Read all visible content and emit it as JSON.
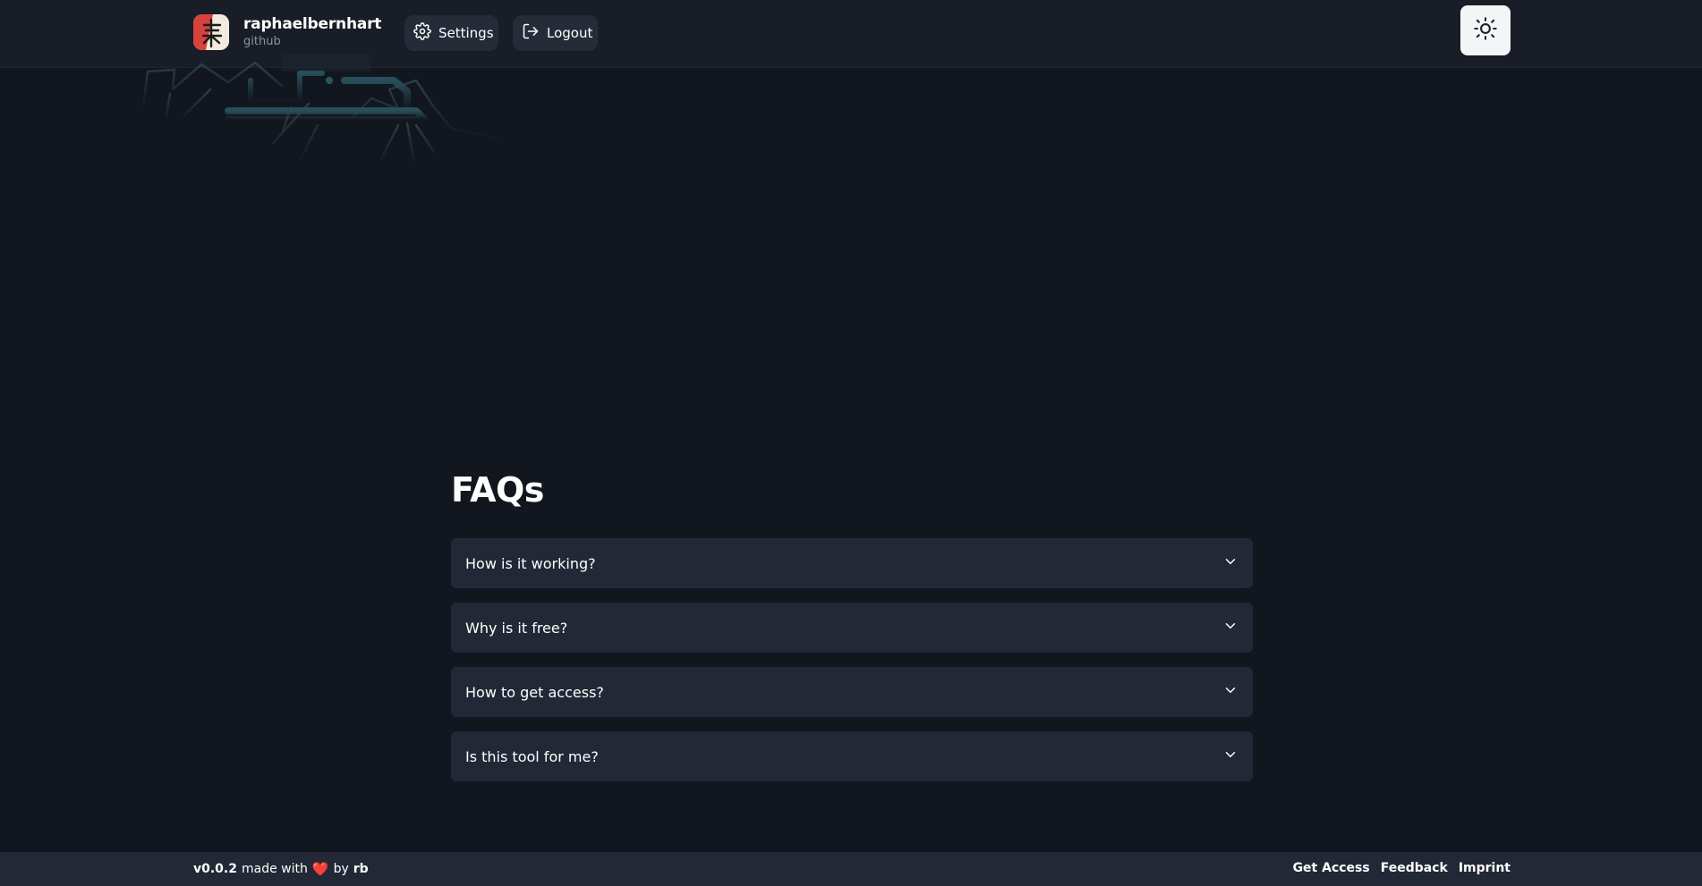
{
  "header": {
    "username": "raphaelbernhart",
    "provider": "github",
    "settings_label": "Settings",
    "logout_label": "Logout",
    "theme_icon": "sun-icon"
  },
  "faq": {
    "title": "FAQs",
    "items": [
      {
        "question": "How is it working?"
      },
      {
        "question": "Why is it free?"
      },
      {
        "question": "How to get access?"
      },
      {
        "question": "Is this tool for me?"
      }
    ]
  },
  "footer": {
    "version": "v0.0.2",
    "made_with": "made with",
    "heart": "❤️",
    "by": "by",
    "author": "rb",
    "links": [
      "Get Access",
      "Feedback",
      "Imprint"
    ]
  },
  "colors": {
    "background": "#12161f",
    "header_bg": "#191d27",
    "card_bg": "#232836",
    "accent_heart": "#e02424"
  }
}
